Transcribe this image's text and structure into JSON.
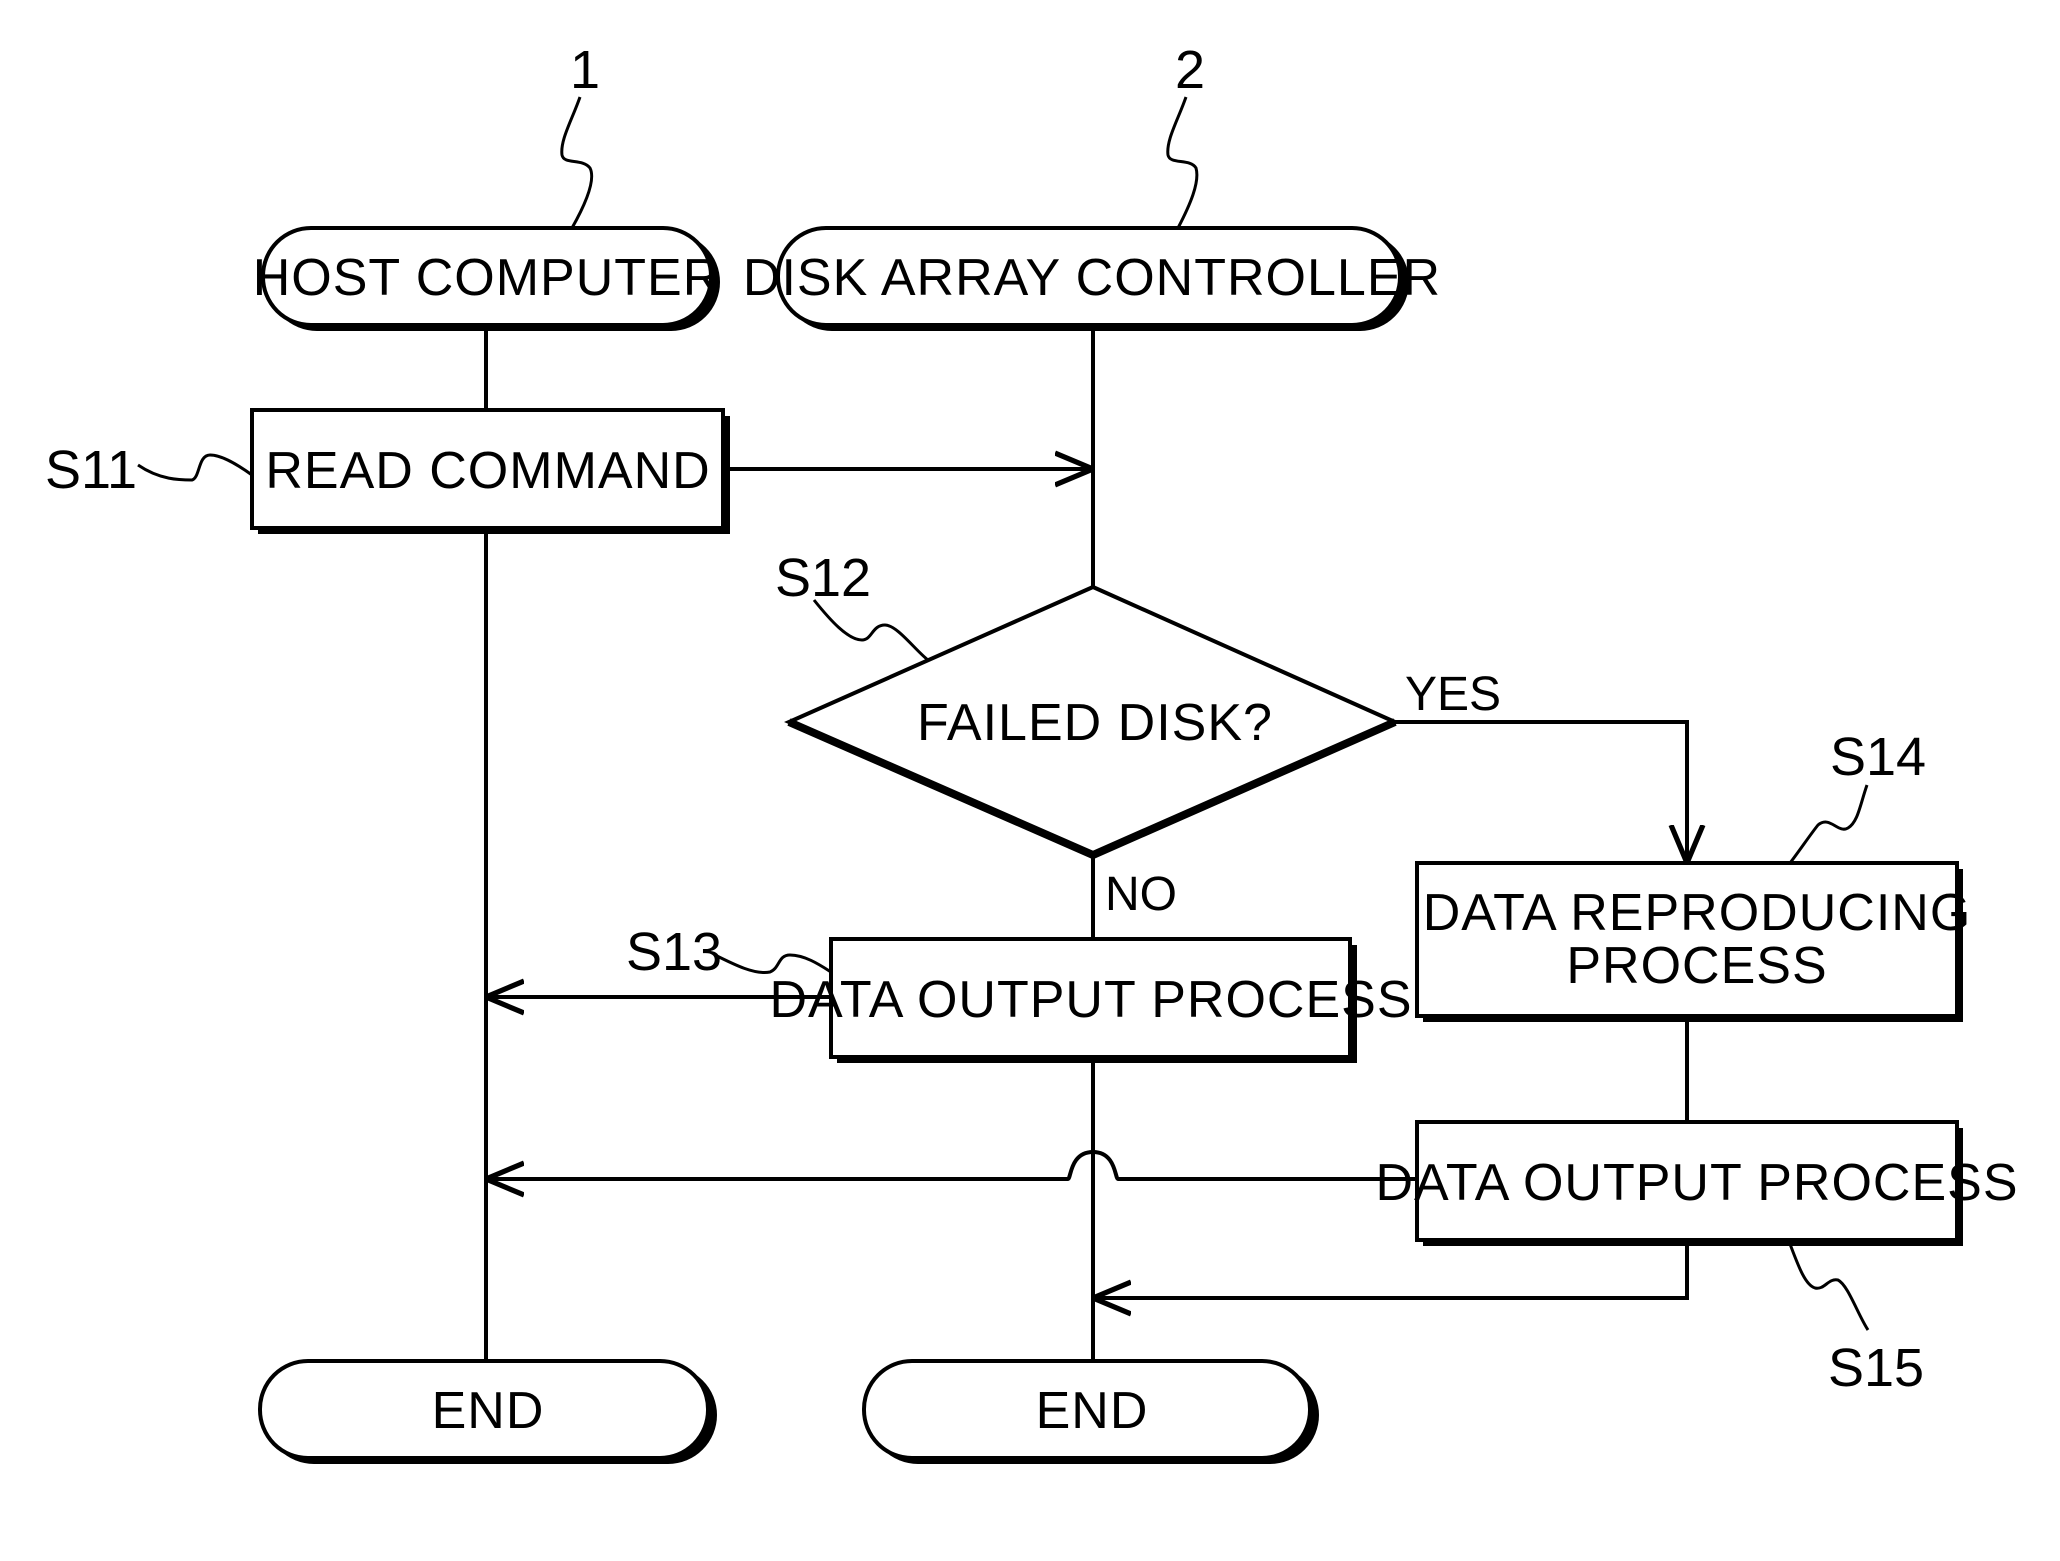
{
  "figure": {
    "type": "flowchart",
    "lanes": [
      {
        "id": "host",
        "ref": "1",
        "label": "HOST COMPUTER"
      },
      {
        "id": "controller",
        "ref": "2",
        "label": "DISK ARRAY CONTROLLER"
      }
    ],
    "steps": {
      "s11": {
        "ref": "S11",
        "label": "READ COMMAND"
      },
      "s12": {
        "ref": "S12",
        "label": "FAILED DISK?"
      },
      "s13": {
        "ref": "S13",
        "label": "DATA OUTPUT PROCESS"
      },
      "s14": {
        "ref": "S14",
        "label_line1": "DATA REPRODUCING",
        "label_line2": "PROCESS"
      },
      "s15": {
        "ref": "S15",
        "label": "DATA OUTPUT PROCESS"
      }
    },
    "branches": {
      "yes": "YES",
      "no": "NO"
    },
    "ends": {
      "host_end": "END",
      "controller_end": "END"
    },
    "edges": [
      {
        "from": "S11",
        "to": "controller"
      },
      {
        "from": "controller",
        "to": "S12"
      },
      {
        "from": "S12",
        "to": "S14",
        "condition": "YES"
      },
      {
        "from": "S12",
        "to": "S13",
        "condition": "NO"
      },
      {
        "from": "S13",
        "to": "host"
      },
      {
        "from": "S14",
        "to": "S15"
      },
      {
        "from": "S15",
        "to": "host"
      },
      {
        "from": "S15",
        "to": "controller"
      }
    ]
  }
}
